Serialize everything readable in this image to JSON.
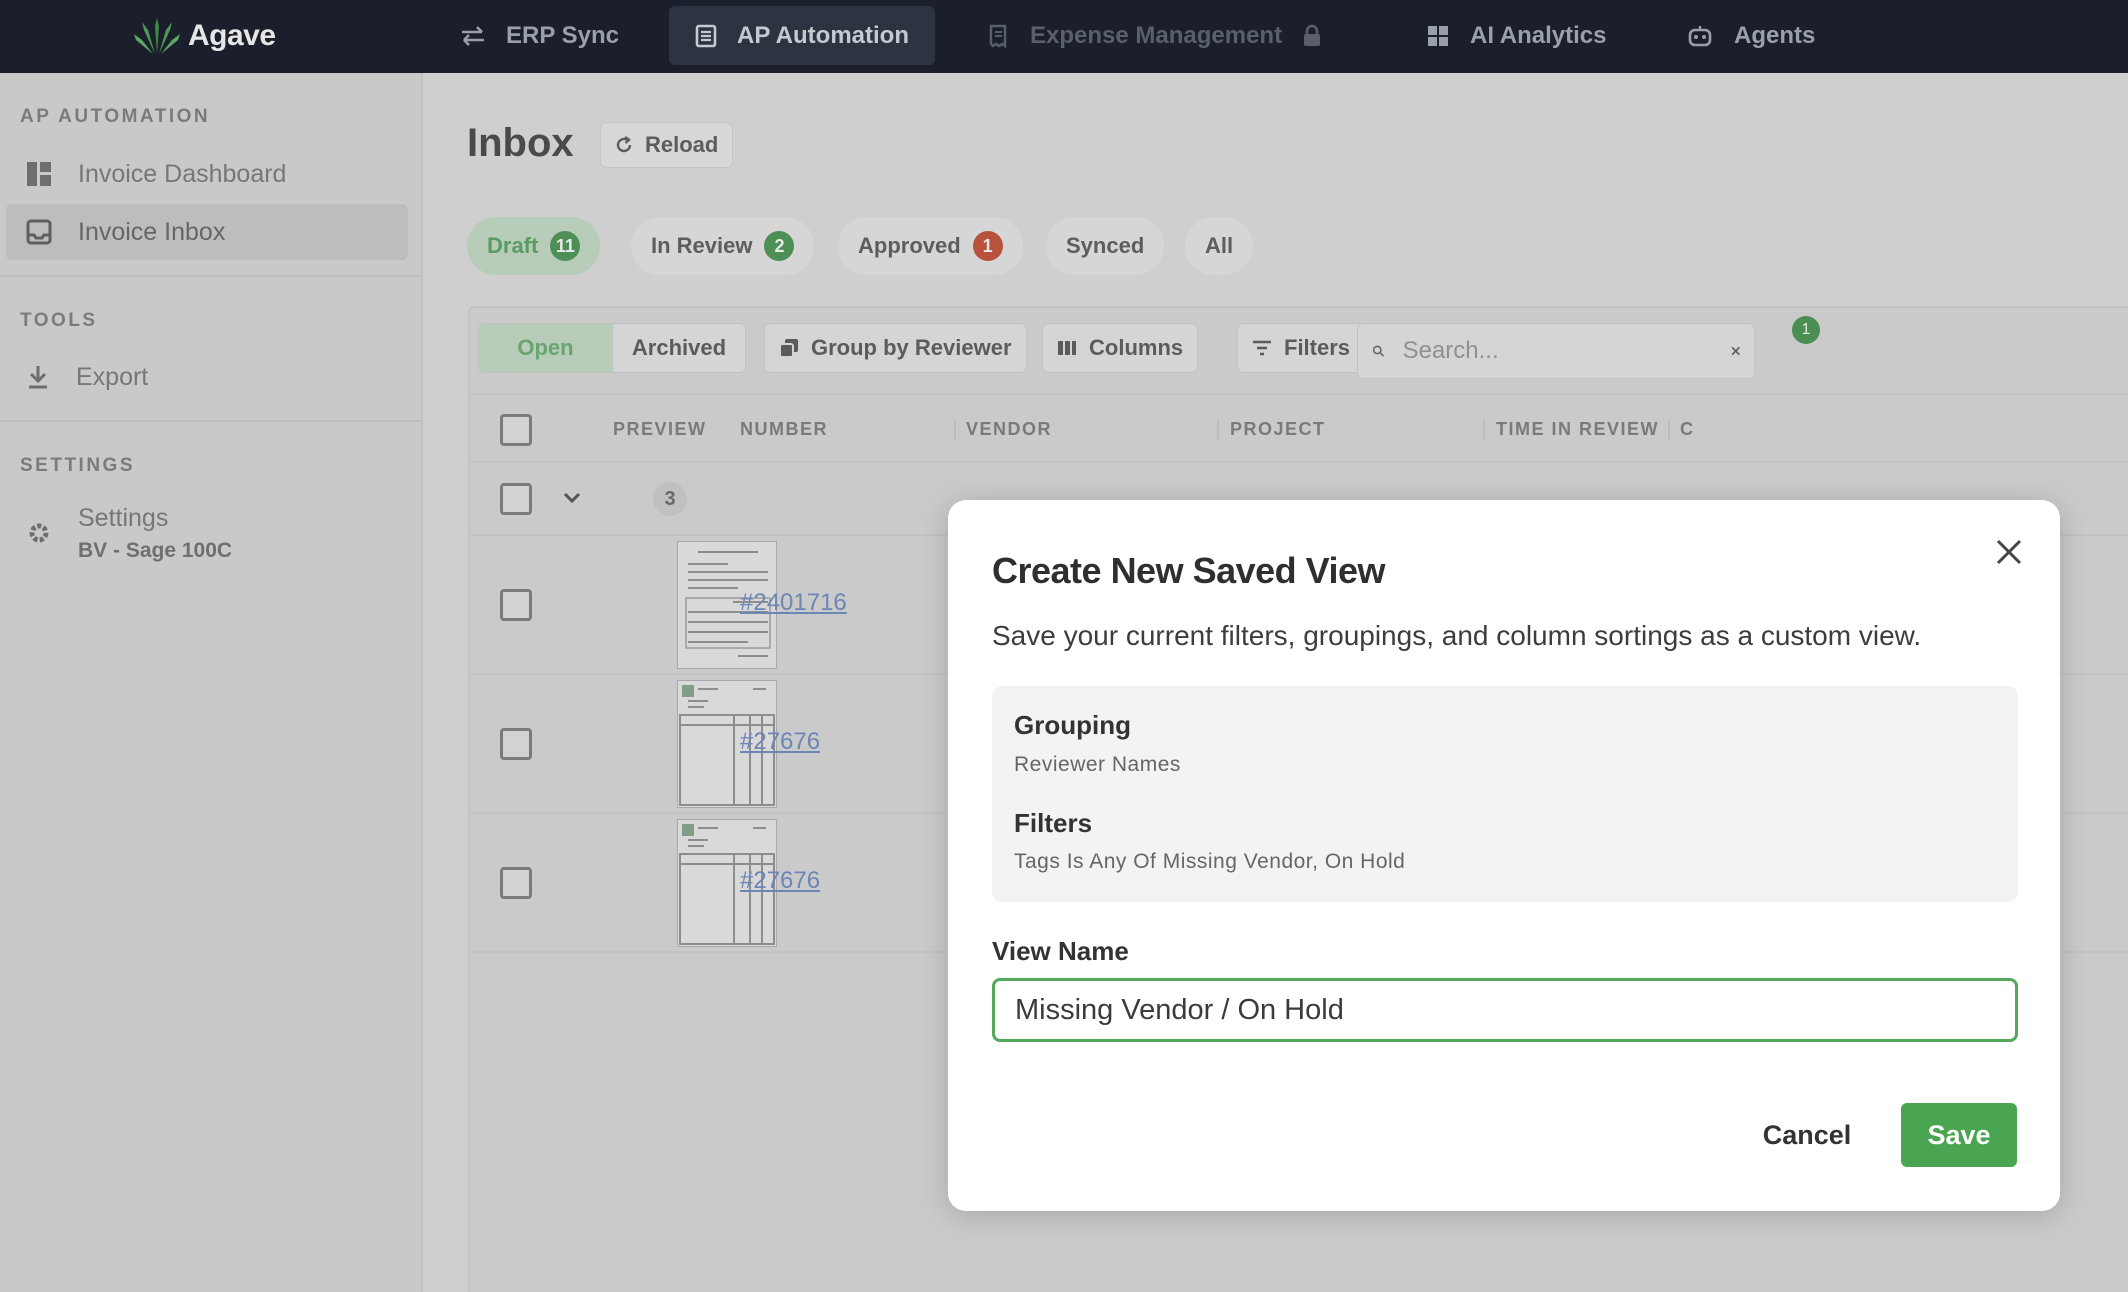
{
  "topnav": {
    "logo_text": "Agave",
    "items": [
      {
        "label": "ERP Sync",
        "icon": "arrows-swap-icon"
      },
      {
        "label": "AP Automation",
        "icon": "document-icon"
      },
      {
        "label": "Expense Management",
        "icon": "receipt-icon",
        "locked": true
      },
      {
        "label": "AI Analytics",
        "icon": "grid-icon"
      },
      {
        "label": "Agents",
        "icon": "robot-icon"
      }
    ]
  },
  "sidebar": {
    "sections": {
      "ap": "AP AUTOMATION",
      "tools": "TOOLS",
      "settings": "SETTINGS"
    },
    "items": {
      "dashboard": "Invoice Dashboard",
      "inbox": "Invoice Inbox",
      "export": "Export",
      "settings": "Settings",
      "settings_sub": "BV - Sage 100C"
    }
  },
  "main": {
    "title": "Inbox",
    "reload_label": "Reload",
    "status_tabs": [
      {
        "label": "Draft",
        "count": "11",
        "active": true
      },
      {
        "label": "In Review",
        "count": "2"
      },
      {
        "label": "Approved",
        "count": "1"
      },
      {
        "label": "Synced"
      },
      {
        "label": "All"
      }
    ],
    "toolbar": {
      "open_label": "Open",
      "archived_label": "Archived",
      "group_label": "Group by Reviewer",
      "columns_label": "Columns",
      "filters_label": "Filters",
      "filters_badge": "1",
      "search_placeholder": "Search..."
    },
    "table": {
      "headers": [
        "PREVIEW",
        "NUMBER",
        "VENDOR",
        "PROJECT",
        "TIME IN REVIEW",
        "C"
      ],
      "group_count": "3",
      "rows": [
        {
          "number": "#2401716"
        },
        {
          "number": "#27676"
        },
        {
          "number": "#27676"
        }
      ]
    }
  },
  "modal": {
    "title": "Create New Saved View",
    "description": "Save your current filters, groupings, and column sortings as a custom view.",
    "grouping_label": "Grouping",
    "grouping_value": "Reviewer Names",
    "filters_label": "Filters",
    "filters_value": "Tags Is Any Of Missing Vendor, On Hold",
    "view_name_label": "View Name",
    "view_name_value": "Missing Vendor / On Hold",
    "cancel_label": "Cancel",
    "save_label": "Save"
  },
  "colors": {
    "topbar": "#1a1f2b",
    "accent_green": "#4aa552",
    "overlay_gray": "#cfcfcf",
    "badge_red": "#b8523c"
  }
}
